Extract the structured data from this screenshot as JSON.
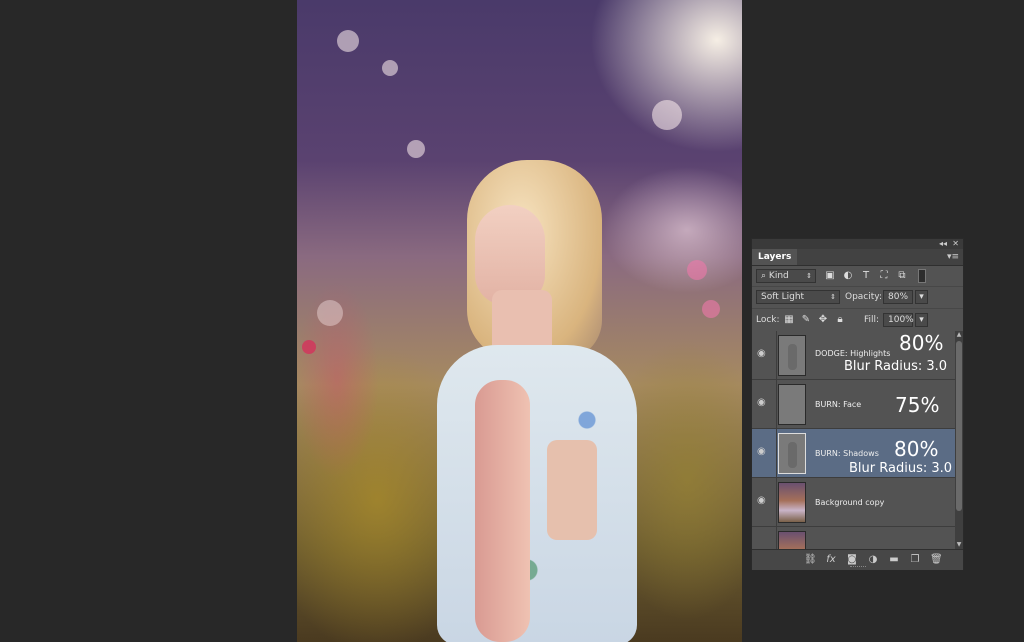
{
  "panel": {
    "tab_label": "Layers",
    "collapse_label": "◂◂",
    "close_label": "✕",
    "menu_label": "▾≡",
    "filter": {
      "kind_label": "Kind",
      "search_glyph": "⌕"
    },
    "blend_mode": "Soft Light",
    "opacity_label": "Opacity:",
    "opacity_value": "80%",
    "lock_label": "Lock:",
    "fill_label": "Fill:",
    "fill_value": "100%",
    "layers": [
      {
        "name": "DODGE: Highlights",
        "overlay_percent": "80%",
        "overlay_blur": "Blur Radius: 3.0",
        "thumb": "mask",
        "selected": false
      },
      {
        "name": "BURN: Face",
        "overlay_percent": "75%",
        "overlay_blur": "",
        "thumb": "gray",
        "selected": false
      },
      {
        "name": "BURN:  Shadows",
        "overlay_percent": "80%",
        "overlay_blur": "Blur Radius: 3.0",
        "thumb": "mask",
        "selected": true
      },
      {
        "name": "Background copy",
        "overlay_percent": "",
        "overlay_blur": "",
        "thumb": "photo",
        "selected": false
      },
      {
        "name": "",
        "overlay_percent": "",
        "overlay_blur": "",
        "thumb": "photo",
        "selected": false
      }
    ],
    "bottom_icons": [
      "link-icon",
      "fx-icon",
      "mask-icon",
      "adjustment-icon",
      "folder-icon",
      "new-layer-icon",
      "trash-icon"
    ],
    "selected_color": "#5b6c85",
    "panel_color": "#535353"
  }
}
